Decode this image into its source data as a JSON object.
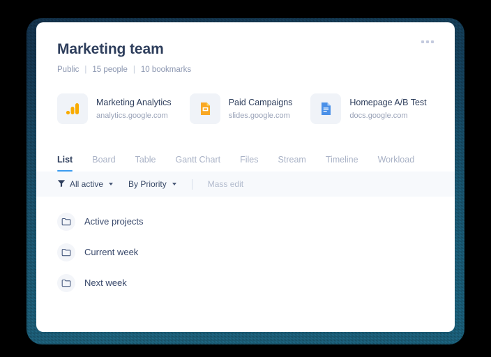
{
  "header": {
    "title": "Marketing team",
    "meta": {
      "visibility": "Public",
      "people": "15 people",
      "bookmarks": "10 bookmarks",
      "separator": "|"
    },
    "more_menu": "more-options"
  },
  "bookmarks": [
    {
      "title": "Marketing Analytics",
      "url": "analytics.google.com",
      "icon": "google-analytics-icon"
    },
    {
      "title": "Paid Campaigns",
      "url": "slides.google.com",
      "icon": "google-slides-icon"
    },
    {
      "title": "Homepage A/B Test",
      "url": "docs.google.com",
      "icon": "google-docs-icon"
    }
  ],
  "tabs": [
    {
      "label": "List",
      "active": true
    },
    {
      "label": "Board",
      "active": false
    },
    {
      "label": "Table",
      "active": false
    },
    {
      "label": "Gantt Chart",
      "active": false
    },
    {
      "label": "Files",
      "active": false
    },
    {
      "label": "Stream",
      "active": false
    },
    {
      "label": "Timeline",
      "active": false
    },
    {
      "label": "Workload",
      "active": false
    }
  ],
  "filterbar": {
    "status_filter": "All active",
    "sort_filter": "By Priority",
    "mass_edit": "Mass edit"
  },
  "list": [
    {
      "label": "Active projects",
      "icon": "folder-icon"
    },
    {
      "label": "Current week",
      "icon": "folder-icon"
    },
    {
      "label": "Next week",
      "icon": "folder-icon"
    }
  ],
  "colors": {
    "accent": "#3c9cf0",
    "title": "#2e3e5c",
    "muted": "#8b96b0",
    "frame": "#14405a",
    "analytics_orange": "#f9ab00",
    "slides_orange": "#f9a825",
    "docs_blue": "#4a90e8"
  }
}
